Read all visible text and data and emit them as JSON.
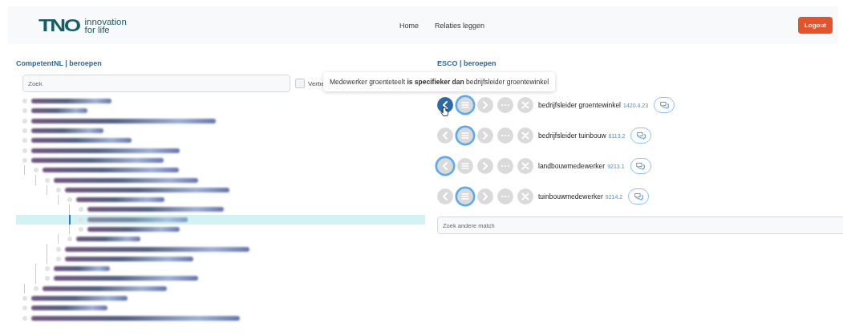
{
  "header": {
    "logo": {
      "mark": "TNO",
      "tagline_1": "innovation",
      "tagline_2": "for life"
    },
    "nav": [
      {
        "label": "Home"
      },
      {
        "label": "Relaties leggen"
      }
    ],
    "logout": "Logout"
  },
  "left": {
    "title": "CompetentNL | beroepen",
    "search": {
      "placeholder": "Zoek"
    },
    "checkbox": {
      "label": "Verbe",
      "checked": false
    },
    "tree": [
      {
        "selected": false
      },
      {
        "selected": false
      },
      {
        "selected": false
      },
      {
        "selected": false
      },
      {
        "selected": false
      },
      {
        "selected": false
      },
      {
        "selected": false,
        "children": [
          {
            "selected": false,
            "children": [
              {
                "selected": false,
                "children": [
                  {
                    "selected": false,
                    "children": [
                      {
                        "selected": false,
                        "children": [
                          {
                            "selected": false
                          },
                          {
                            "selected": true
                          },
                          {
                            "selected": false
                          }
                        ]
                      },
                      {
                        "selected": false
                      }
                    ]
                  },
                  {
                    "selected": false
                  },
                  {
                    "selected": false
                  }
                ]
              },
              {
                "selected": false
              },
              {
                "selected": false
              }
            ]
          },
          {
            "selected": false
          }
        ]
      },
      {
        "selected": false
      },
      {
        "selected": false
      },
      {
        "selected": false
      }
    ]
  },
  "right": {
    "title": "ESCO | beroepen",
    "tooltip": "Medewerker groenteteelt **is specifieker dan** bedrijfsleider groentewinkel",
    "matches": [
      {
        "name": "bedrijfsleider groentewinkel",
        "code": "1420.4.23",
        "buttons": [
          {
            "kind": "prev",
            "selected": false,
            "hovered": true
          },
          {
            "kind": "equal",
            "selected": true,
            "hovered": false
          },
          {
            "kind": "next",
            "selected": false,
            "hovered": false
          },
          {
            "kind": "more",
            "selected": false,
            "hovered": false
          },
          {
            "kind": "none",
            "selected": false,
            "hovered": false
          }
        ]
      },
      {
        "name": "bedrijfsleider tuinbouw",
        "code": "6113.2",
        "buttons": [
          {
            "kind": "prev",
            "selected": false,
            "hovered": false
          },
          {
            "kind": "equal",
            "selected": true,
            "hovered": false
          },
          {
            "kind": "next",
            "selected": false,
            "hovered": false
          },
          {
            "kind": "more",
            "selected": false,
            "hovered": false
          },
          {
            "kind": "none",
            "selected": false,
            "hovered": false
          }
        ]
      },
      {
        "name": "landbouwmedewerker",
        "code": "9213.1",
        "buttons": [
          {
            "kind": "prev",
            "selected": true,
            "hovered": false
          },
          {
            "kind": "equal",
            "selected": false,
            "hovered": false
          },
          {
            "kind": "next",
            "selected": false,
            "hovered": false
          },
          {
            "kind": "more",
            "selected": false,
            "hovered": false
          },
          {
            "kind": "none",
            "selected": false,
            "hovered": false
          }
        ]
      },
      {
        "name": "tuinbouwmedewerker",
        "code": "9214.2",
        "buttons": [
          {
            "kind": "prev",
            "selected": false,
            "hovered": false
          },
          {
            "kind": "equal",
            "selected": true,
            "hovered": false
          },
          {
            "kind": "next",
            "selected": false,
            "hovered": false
          },
          {
            "kind": "more",
            "selected": false,
            "hovered": false
          },
          {
            "kind": "none",
            "selected": false,
            "hovered": false
          }
        ]
      }
    ],
    "search": {
      "placeholder": "Zoek andere match"
    }
  }
}
